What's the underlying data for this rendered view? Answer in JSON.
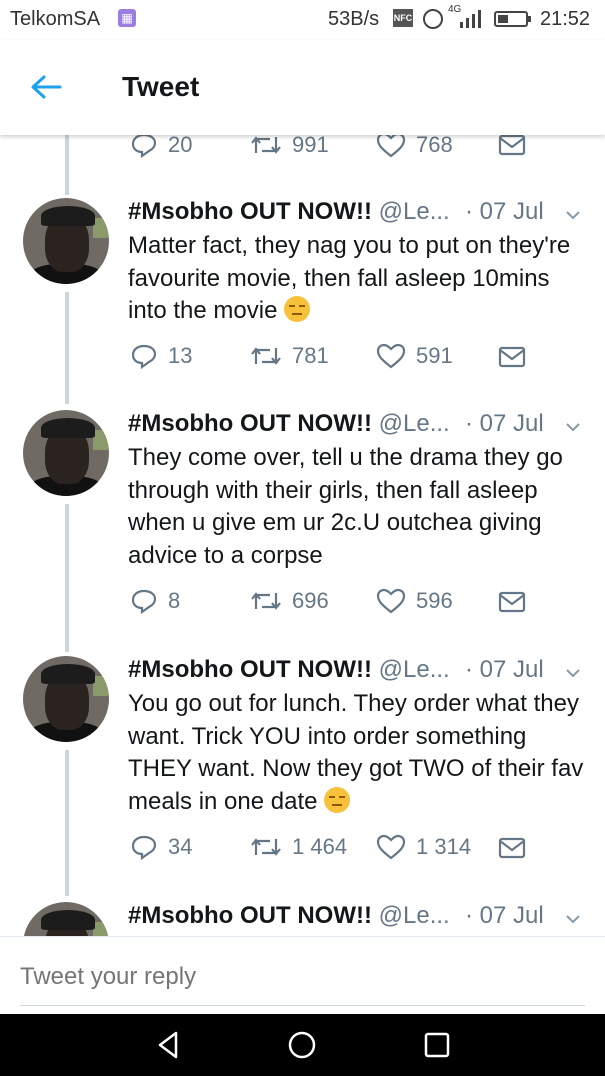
{
  "status_bar": {
    "carrier": "TelkomSA",
    "speed": "53B/s",
    "nfc": "NFC",
    "network": "4G",
    "time": "21:52"
  },
  "header": {
    "title": "Tweet"
  },
  "top_actions": {
    "replies": "20",
    "retweets": "991",
    "likes": "768"
  },
  "tweets": [
    {
      "name": "#Msobho OUT NOW!!",
      "handle": "@Le...",
      "date": "· 07 Jul",
      "text": "Matter fact, they nag you to put on they're favourite movie, then fall asleep 10mins into the movie",
      "replies": "13",
      "retweets": "781",
      "likes": "591"
    },
    {
      "name": "#Msobho OUT NOW!!",
      "handle": "@Le...",
      "date": "· 07 Jul",
      "text": "They come over, tell u the drama they go through with their girls, then fall asleep when u give em ur 2c.U outchea giving advice to a corpse",
      "replies": "8",
      "retweets": "696",
      "likes": "596"
    },
    {
      "name": "#Msobho OUT NOW!!",
      "handle": "@Le...",
      "date": "· 07 Jul",
      "text": "You go out for lunch. They order what they want. Trick YOU into order something THEY want. Now they got TWO of their fav meals in one date",
      "replies": "34",
      "retweets": "1 464",
      "likes": "1 314"
    },
    {
      "name": "#Msobho OUT NOW!!",
      "handle": "@Le...",
      "date": "· 07 Jul"
    }
  ],
  "reply": {
    "placeholder": "Tweet your reply"
  },
  "colors": {
    "accent": "#1da1f2",
    "muted": "#657786",
    "thread": "#ccd6dd"
  }
}
